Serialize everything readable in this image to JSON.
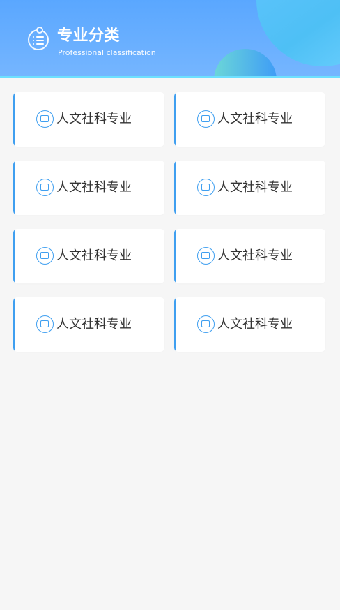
{
  "header": {
    "title": "专业分类",
    "subtitle": "Professional classification",
    "icon": "list-icon",
    "colors": {
      "background": "#5aa7ff",
      "accent": "#3f9ff0",
      "decor_cyan": "#63c4ff"
    }
  },
  "categories": [
    {
      "label": "人文社科专业",
      "icon": "book-icon"
    },
    {
      "label": "人文社科专业",
      "icon": "book-icon"
    },
    {
      "label": "人文社科专业",
      "icon": "book-icon"
    },
    {
      "label": "人文社科专业",
      "icon": "book-icon"
    },
    {
      "label": "人文社科专业",
      "icon": "book-icon"
    },
    {
      "label": "人文社科专业",
      "icon": "book-icon"
    },
    {
      "label": "人文社科专业",
      "icon": "book-icon"
    },
    {
      "label": "人文社科专业",
      "icon": "book-icon"
    }
  ]
}
